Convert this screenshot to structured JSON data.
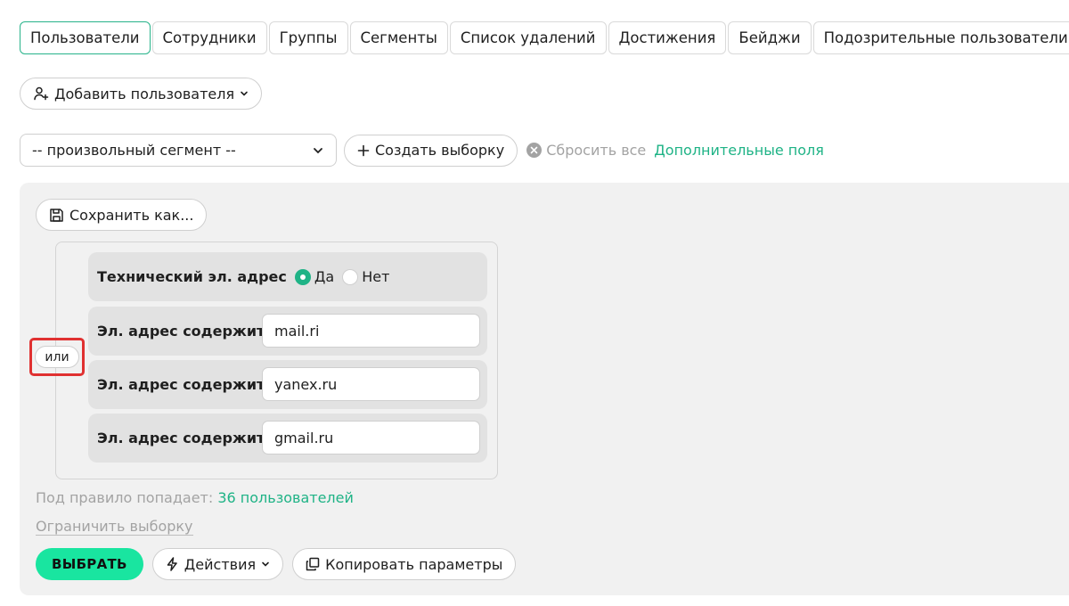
{
  "tabs": [
    {
      "label": "Пользователи",
      "active": true
    },
    {
      "label": "Сотрудники"
    },
    {
      "label": "Группы"
    },
    {
      "label": "Сегменты"
    },
    {
      "label": "Список удалений"
    },
    {
      "label": "Достижения"
    },
    {
      "label": "Бейджи"
    },
    {
      "label": "Подозрительные пользователи"
    }
  ],
  "toolbar": {
    "add_user_label": "Добавить пользователя"
  },
  "filter": {
    "segment_value": "-- произвольный сегмент --",
    "create_sample_label": "Создать выборку",
    "reset_label": "Сбросить все",
    "extra_fields_label": "Дополнительные поля"
  },
  "panel": {
    "save_as_label": "Сохранить как...",
    "rule_tech_email": {
      "label": "Технический эл. адрес",
      "yes": "Да",
      "no": "Нет",
      "selected": "Да"
    },
    "email_rules": [
      {
        "label": "Эл. адрес содержит",
        "value": "mail.ri"
      },
      {
        "label": "Эл. адрес содержит",
        "value": "yanex.ru"
      },
      {
        "label": "Эл. адрес содержит",
        "value": "gmail.ru"
      }
    ],
    "or_label": "или",
    "matches_prefix": "Под правило попадает:",
    "matches_count": "36 пользователей",
    "limit_label": "Ограничить выборку",
    "select_label": "ВЫБРАТЬ",
    "actions_label": "Действия",
    "copy_params_label": "Копировать параметры"
  },
  "colors": {
    "accent": "#1fb386",
    "primary_button": "#19e5a0",
    "highlight": "#e03131"
  }
}
